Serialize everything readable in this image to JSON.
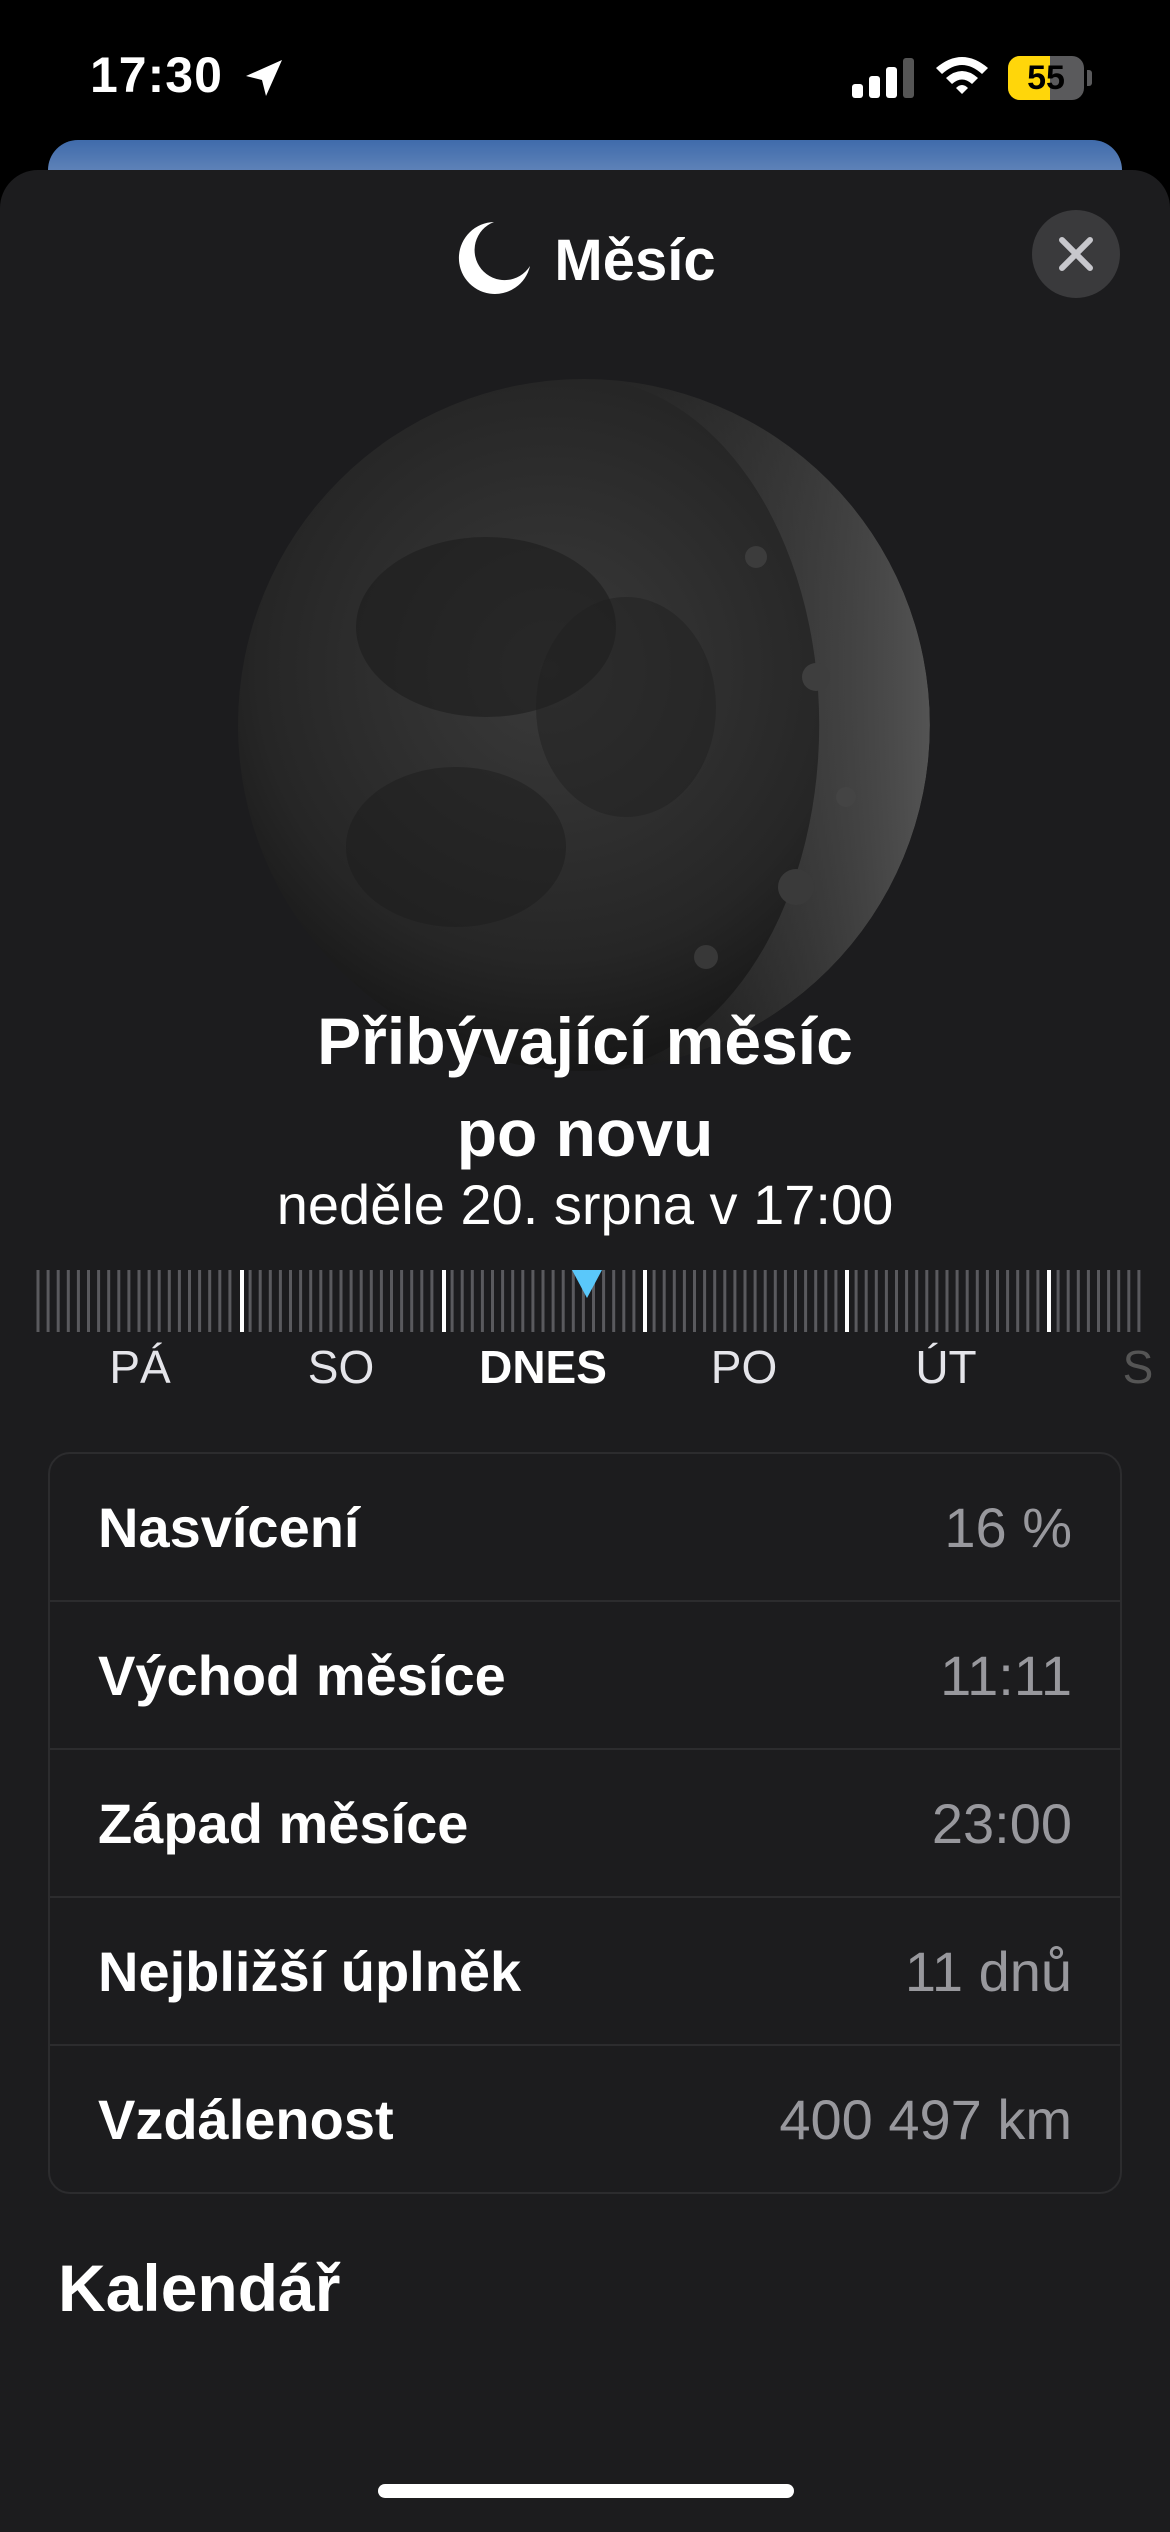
{
  "status_bar": {
    "time": "17:30",
    "battery": "55",
    "battery_level": 0.55
  },
  "sheet": {
    "title": "Měsíc",
    "close_icon": "close-icon"
  },
  "phase": {
    "name_line1": "Přibývající měsíc",
    "name_line2": "po novu",
    "date": "neděle 20. srpna v 17:00",
    "illumination_fraction": 0.16
  },
  "timeline": {
    "days": [
      "PÁ",
      "SO",
      "DNES",
      "PO",
      "ÚT",
      "S"
    ],
    "today_index": 2,
    "marker_color": "#5ac8fa"
  },
  "info": {
    "rows": [
      {
        "label": "Nasvícení",
        "value": "16 %"
      },
      {
        "label": "Východ měsíce",
        "value": "11:11"
      },
      {
        "label": "Západ měsíce",
        "value": "23:00"
      },
      {
        "label": "Nejbližší úplněk",
        "value": "11 dnů"
      },
      {
        "label": "Vzdálenost",
        "value": "400 497 km"
      }
    ]
  },
  "calendar": {
    "title": "Kalendář"
  }
}
